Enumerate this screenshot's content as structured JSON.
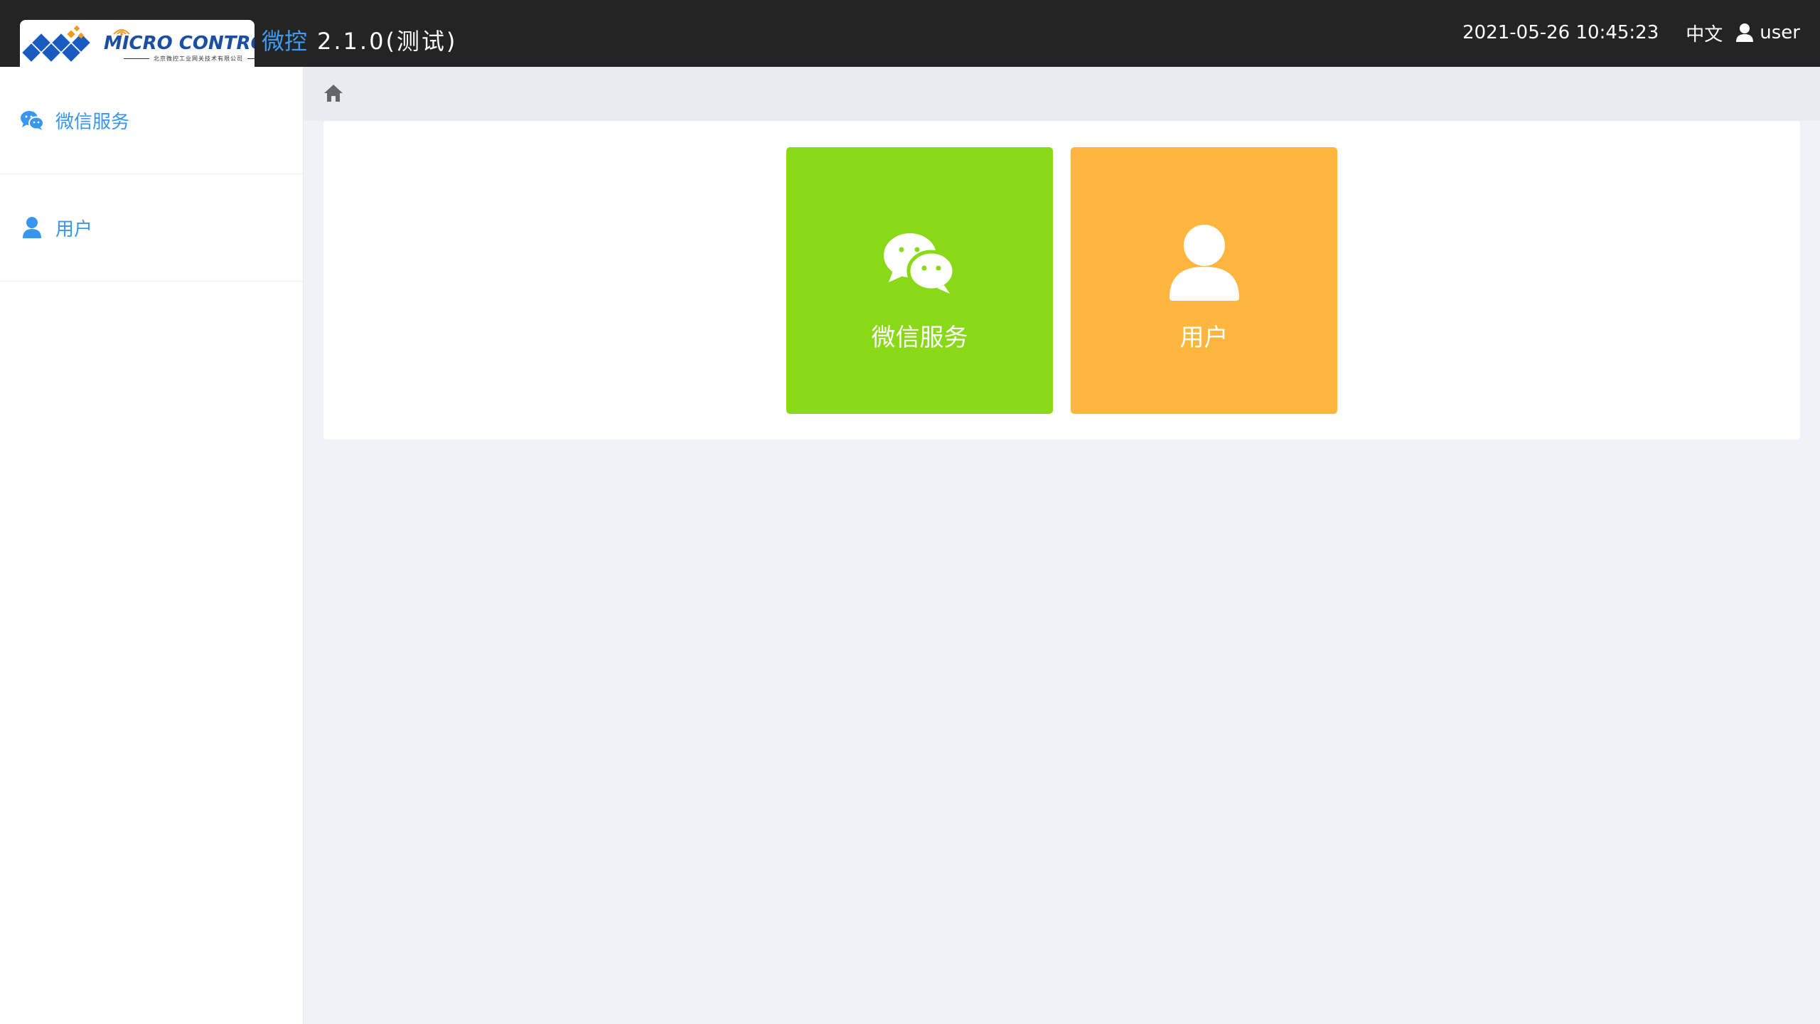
{
  "header": {
    "logo_text": "MICRO CONTROL",
    "logo_subtext": "北京微控工业网关技术有限公司",
    "brand": "微控",
    "version": "2.1.0(测试)",
    "datetime": "2021-05-26 10:45:23",
    "language": "中文",
    "username": "user"
  },
  "sidebar": {
    "items": [
      {
        "label": "微信服务",
        "icon": "wechat-icon"
      },
      {
        "label": "用户",
        "icon": "user-icon"
      }
    ]
  },
  "breadcrumb": {
    "icon": "home-icon"
  },
  "tiles": [
    {
      "label": "微信服务",
      "icon": "wechat-icon",
      "color": "#8ad918"
    },
    {
      "label": "用户",
      "icon": "user-icon",
      "color": "#ffb63f"
    }
  ],
  "colors": {
    "header_bg": "#242424",
    "accent": "#3b9df8",
    "content_bg": "#eff2f7"
  }
}
